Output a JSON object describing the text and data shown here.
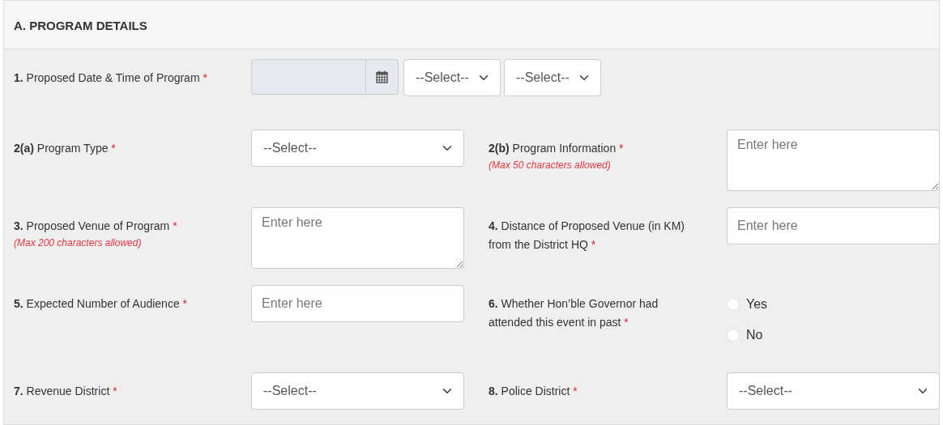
{
  "section": {
    "title": "A. PROGRAM DETAILS"
  },
  "rows": [
    [
      {
        "number": "1.",
        "label": "Proposed Date & Time of Program",
        "required_mark": "*",
        "control": {
          "kind": "datetime",
          "disabled": true,
          "selects": [
            "--Select--",
            "--Select--"
          ]
        }
      }
    ],
    [
      {
        "number": "2(a)",
        "label": "Program Type",
        "required_mark": "*",
        "control": {
          "kind": "select",
          "value": "--Select--"
        }
      },
      {
        "number": "2(b)",
        "label": "Program Information",
        "required_mark": "*",
        "note": "(Max 50 characters allowed)",
        "control": {
          "kind": "textarea",
          "placeholder": "Enter here"
        }
      }
    ],
    [
      {
        "number": "3.",
        "label": "Proposed Venue of Program",
        "required_mark": "*",
        "note": "(Max 200 characters allowed)",
        "control": {
          "kind": "textarea",
          "placeholder": "Enter here"
        }
      },
      {
        "number": "4.",
        "label": "Distance of Proposed Venue (in KM) from the District HQ",
        "required_mark": "*",
        "control": {
          "kind": "text",
          "placeholder": "Enter here"
        }
      }
    ],
    [
      {
        "number": "5.",
        "label": "Expected Number of Audience",
        "required_mark": "*",
        "control": {
          "kind": "text",
          "placeholder": "Enter here"
        }
      },
      {
        "number": "6.",
        "label": "Whether Hon’ble Governor had attended this event in past",
        "required_mark": "*",
        "control": {
          "kind": "radio",
          "options": [
            {
              "label": "Yes",
              "selected": false
            },
            {
              "label": "No",
              "selected": false
            }
          ]
        }
      }
    ],
    [
      {
        "number": "7.",
        "label": "Revenue District",
        "required_mark": "*",
        "control": {
          "kind": "select",
          "value": "--Select--"
        }
      },
      {
        "number": "8.",
        "label": "Police District",
        "required_mark": "*",
        "control": {
          "kind": "select",
          "value": "--Select--"
        }
      }
    ]
  ]
}
